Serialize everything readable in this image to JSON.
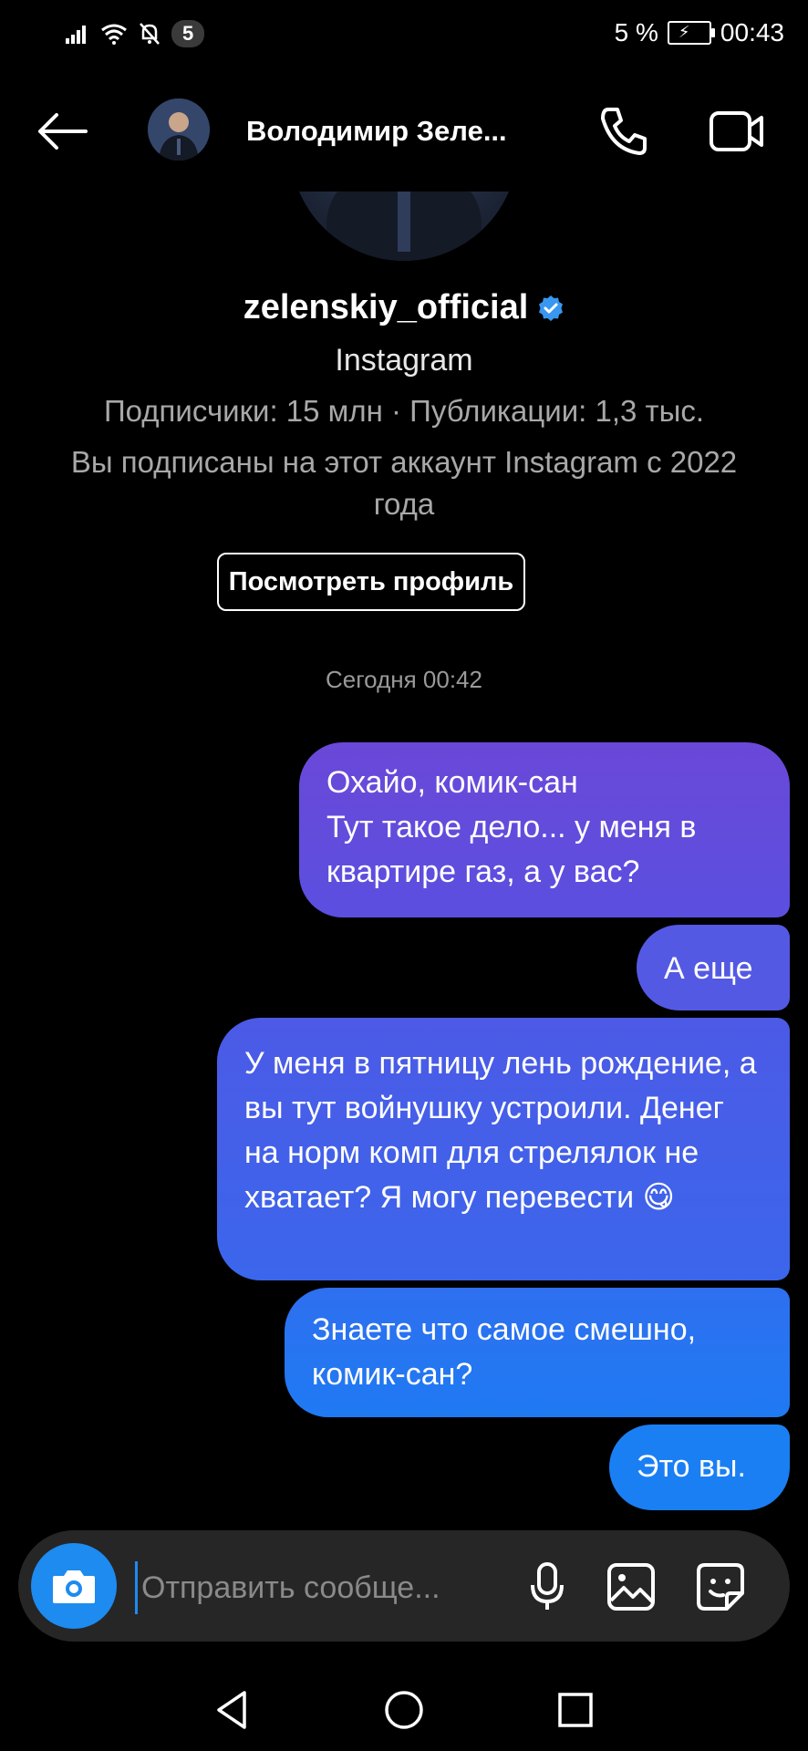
{
  "status_bar": {
    "notification_count": "5",
    "battery_percent": "5 %",
    "time": "00:43"
  },
  "header": {
    "contact_name": "Володимир Зеле..."
  },
  "profile": {
    "username": "zelenskiy_official",
    "platform": "Instagram",
    "stats": "Подписчики: 15 млн · Публикации: 1,3 тыс.",
    "follow_note": "Вы подписаны на этот аккаунт Instagram с 2022 года",
    "view_profile_label": "Посмотреть профиль"
  },
  "chat": {
    "timestamp": "Сегодня 00:42",
    "messages": [
      {
        "text": "Охайо, комик-сан\nТут такое дело... у меня в квартире газ, а у вас?"
      },
      {
        "text": "А еще"
      },
      {
        "text": "У меня в пятницу лень рождение, а вы тут войнушку устроили. Денег на норм комп для стрелялок не хватает? Я могу перевести 😋"
      },
      {
        "text": "Знаете что самое смешно, комик-сан?"
      },
      {
        "text": "Это вы."
      }
    ]
  },
  "composer": {
    "placeholder": "Отправить сообще..."
  },
  "colors": {
    "accent": "#1d8bf0",
    "bubble_top": "#6a48d8",
    "bubble_bottom": "#1a7ff3",
    "verified": "#3897f0"
  }
}
